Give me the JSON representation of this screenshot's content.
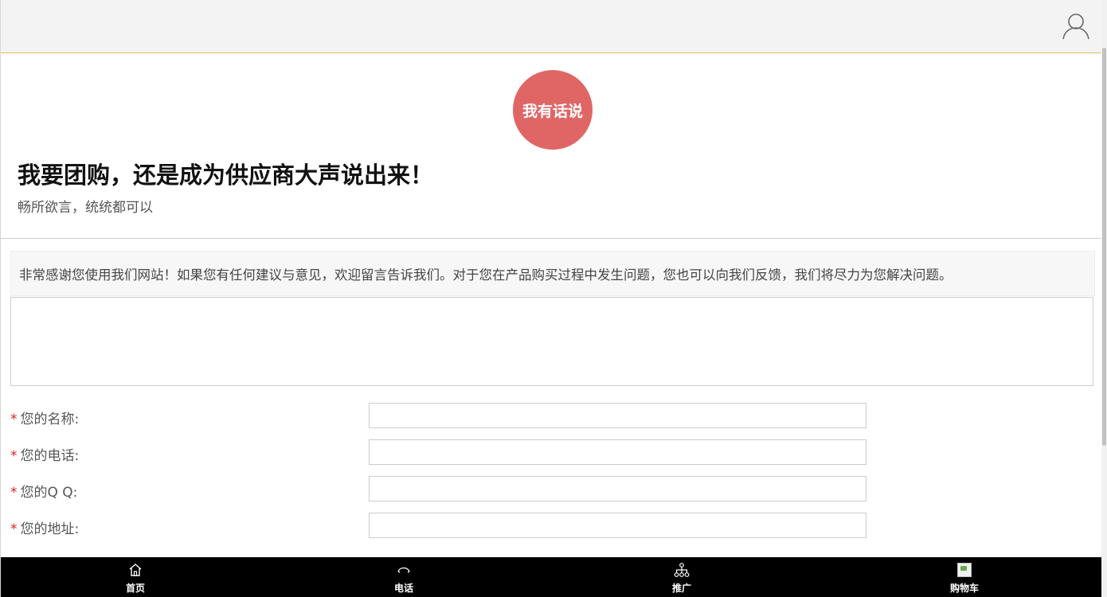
{
  "header": {
    "user_icon": "user-icon"
  },
  "hero": {
    "badge": "我有话说",
    "title": "我要团购，还是成为供应商大声说出来！",
    "subtitle": "畅所欲言，统统都可以"
  },
  "notice": {
    "text": "非常感谢您使用我们网站！如果您有任何建议与意见，欢迎留言告诉我们。对于您在产品购买过程中发生问题，您也可以向我们反馈，我们将尽力为您解决问题。"
  },
  "form": {
    "required_mark": "*",
    "message_value": "",
    "fields": [
      {
        "label": "您的名称:",
        "value": ""
      },
      {
        "label": "您的电话:",
        "value": ""
      },
      {
        "label": "您的Q Q:",
        "value": ""
      },
      {
        "label": "您的地址:",
        "value": ""
      }
    ]
  },
  "bottom_nav": {
    "items": [
      {
        "label": "首页",
        "icon": "home-icon"
      },
      {
        "label": "电话",
        "icon": "phone-icon"
      },
      {
        "label": "推广",
        "icon": "network-icon"
      },
      {
        "label": "购物车",
        "icon": "cart-image-icon"
      }
    ]
  },
  "colors": {
    "header_bg": "#f3f3f3",
    "header_border": "#e5c158",
    "badge_bg": "#e06666",
    "required": "#e02020",
    "nav_bg": "#000000"
  }
}
